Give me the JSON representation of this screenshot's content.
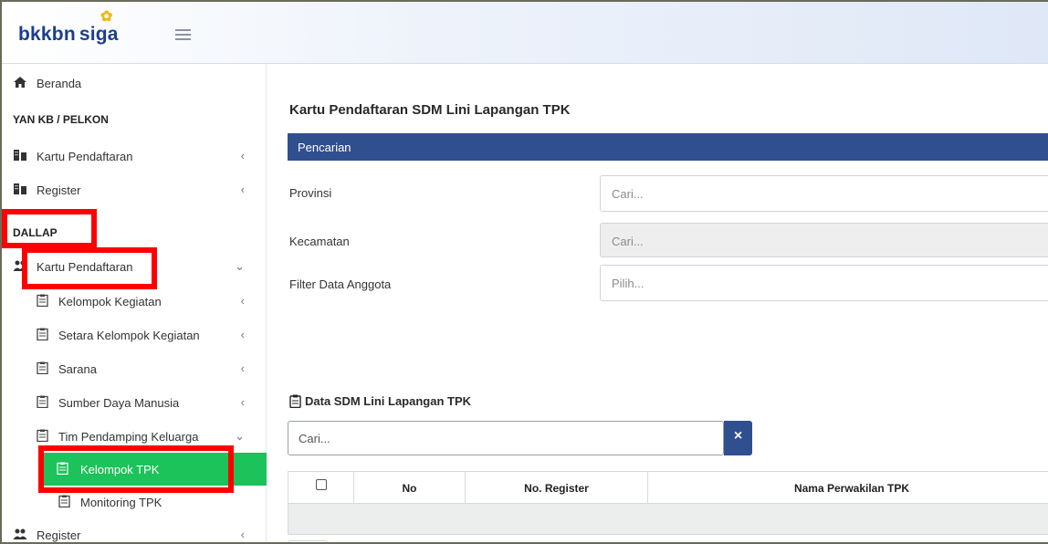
{
  "brand": {
    "left": "bkkbn",
    "right": "siga"
  },
  "sidebar": {
    "beranda": "Beranda",
    "section_yankb": "YAN KB / PELKON",
    "kartu_pendaftaran_1": "Kartu Pendaftaran",
    "register_1": "Register",
    "section_dallap": "DALLAP",
    "kartu_pendaftaran_2": "Kartu Pendaftaran",
    "sub": [
      {
        "label": "Kelompok Kegiatan"
      },
      {
        "label": "Setara Kelompok Kegiatan"
      },
      {
        "label": "Sarana"
      },
      {
        "label": "Sumber Daya Manusia"
      },
      {
        "label": "Tim Pendamping Keluarga"
      }
    ],
    "active_item": "Kelompok TPK",
    "monitoring": "Monitoring TPK",
    "register_2": "Register",
    "arrow_collapsed": "‹",
    "arrow_expanded": "⌄"
  },
  "main": {
    "title": "Kartu Pendaftaran SDM Lini Lapangan TPK",
    "panel_title": "Pencarian",
    "fields": [
      {
        "label": "Provinsi",
        "placeholder": "Cari..."
      },
      {
        "label": "Kecamatan",
        "placeholder": "Cari..."
      },
      {
        "label": "Filter Data Anggota",
        "placeholder": "Pilih..."
      }
    ],
    "data_title": "Data SDM Lini Lapangan TPK",
    "search_placeholder": "Cari...",
    "clear_label": "×",
    "columns": [
      "No",
      "No. Register",
      "Nama Perwakilan TPK"
    ]
  },
  "colors": {
    "accent": "#2f4f8f",
    "active": "#1cc25a",
    "highlight": "#ff0000"
  },
  "icons": [
    "home-icon",
    "building-icon",
    "users-icon",
    "clipboard-icon",
    "menu-icon",
    "close-icon"
  ]
}
